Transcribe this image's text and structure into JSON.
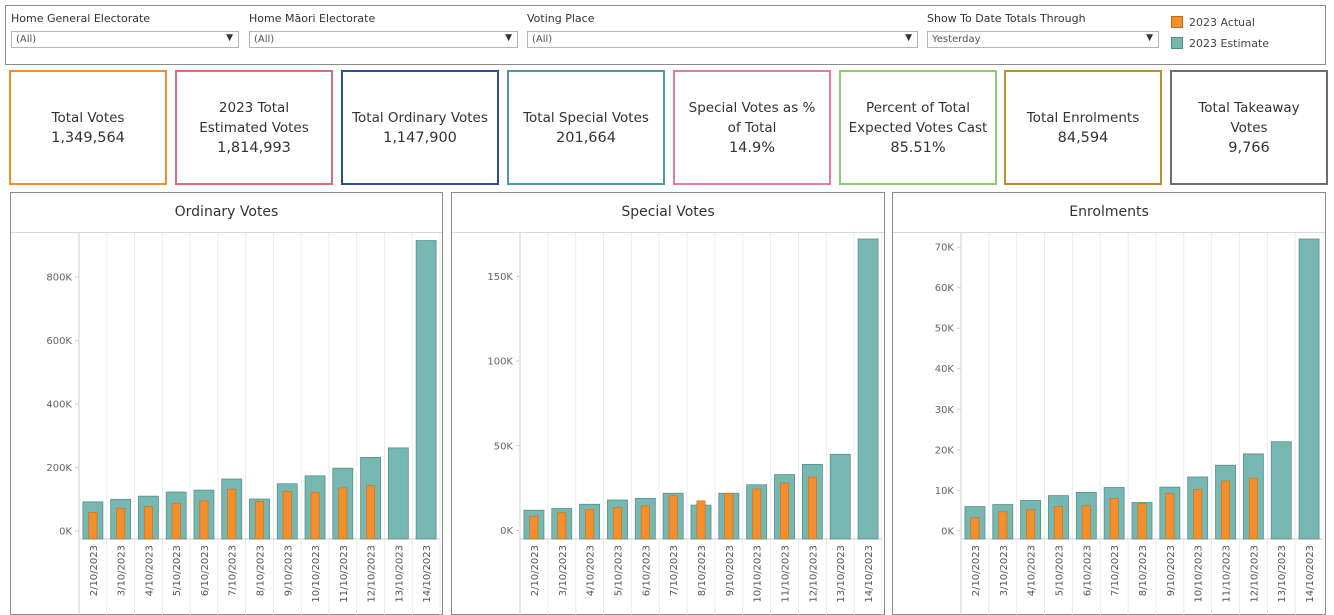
{
  "filters": [
    {
      "label": "Home General Electorate",
      "value": "(All)"
    },
    {
      "label": "Home Māori Electorate",
      "value": "(All)"
    },
    {
      "label": "Voting Place",
      "value": "(All)"
    },
    {
      "label": "Show To Date Totals Through",
      "value": "Yesterday"
    }
  ],
  "legend": {
    "actual": "2023 Actual",
    "estimate": "2023 Estimate"
  },
  "colors": {
    "actual": "#f28e2b",
    "estimate": "#76b7b2"
  },
  "kpis": [
    {
      "title": "Total Votes",
      "value": "1,349,564",
      "color": "#f28e2b"
    },
    {
      "title": "2023 Total Estimated Votes",
      "value": "1,814,993",
      "color": "#e06b7a"
    },
    {
      "title": "Total Ordinary Votes",
      "value": "1,147,900",
      "color": "#2e4ea6"
    },
    {
      "title": "Total Special Votes",
      "value": "201,664",
      "color": "#4e9b98"
    },
    {
      "title": "Special Votes as % of Total",
      "value": "14.9%",
      "color": "#e37aa2"
    },
    {
      "title": "Percent of Total Expected Votes Cast",
      "value": "85.51%",
      "color": "#8ccc6e"
    },
    {
      "title": "Total Enrolments",
      "value": "84,594",
      "color": "#b8912e"
    },
    {
      "title": "Total Takeaway Votes",
      "value": "9,766",
      "color": "#6d6d6d"
    }
  ],
  "chart_data": [
    {
      "type": "bar",
      "title": "Ordinary Votes",
      "categories": [
        "2/10/2023",
        "3/10/2023",
        "4/10/2023",
        "5/10/2023",
        "6/10/2023",
        "7/10/2023",
        "8/10/2023",
        "9/10/2023",
        "10/10/2023",
        "11/10/2023",
        "12/10/2023",
        "13/10/2023",
        "14/10/2023"
      ],
      "series": [
        {
          "name": "2023 Estimate",
          "values": [
            92000,
            100000,
            110000,
            123000,
            129000,
            164000,
            101000,
            149000,
            174000,
            198000,
            232000,
            262000,
            915000
          ]
        },
        {
          "name": "2023 Actual",
          "values": [
            59000,
            72000,
            77000,
            88000,
            95000,
            132000,
            94000,
            125000,
            122000,
            136000,
            143000,
            null,
            null
          ]
        }
      ],
      "ylim": [
        -25000,
        920000
      ],
      "yticks": [
        0,
        200000,
        400000,
        600000,
        800000
      ],
      "ytick_labels": [
        "0K",
        "200K",
        "400K",
        "600K",
        "800K"
      ]
    },
    {
      "type": "bar",
      "title": "Special Votes",
      "categories": [
        "2/10/2023",
        "3/10/2023",
        "4/10/2023",
        "5/10/2023",
        "6/10/2023",
        "7/10/2023",
        "8/10/2023",
        "9/10/2023",
        "10/10/2023",
        "11/10/2023",
        "12/10/2023",
        "13/10/2023",
        "14/10/2023"
      ],
      "series": [
        {
          "name": "2023 Estimate",
          "values": [
            12000,
            13000,
            15500,
            18000,
            19000,
            22000,
            15000,
            22000,
            27000,
            33000,
            39000,
            45000,
            172000
          ]
        },
        {
          "name": "2023 Actual",
          "values": [
            8500,
            10500,
            12500,
            13500,
            14500,
            20500,
            17500,
            22000,
            24500,
            28000,
            31500,
            null,
            null
          ]
        }
      ],
      "ylim": [
        -5000,
        172000
      ],
      "yticks": [
        0,
        50000,
        100000,
        150000
      ],
      "ytick_labels": [
        "0K",
        "50K",
        "100K",
        "150K"
      ]
    },
    {
      "type": "bar",
      "title": "Enrolments",
      "categories": [
        "2/10/2023",
        "3/10/2023",
        "4/10/2023",
        "5/10/2023",
        "6/10/2023",
        "7/10/2023",
        "8/10/2023",
        "9/10/2023",
        "10/10/2023",
        "11/10/2023",
        "12/10/2023",
        "13/10/2023",
        "14/10/2023"
      ],
      "series": [
        {
          "name": "2023 Estimate",
          "values": [
            6000,
            6500,
            7500,
            8700,
            9500,
            10700,
            7000,
            10800,
            13300,
            16200,
            19000,
            22000,
            72000
          ]
        },
        {
          "name": "2023 Actual",
          "values": [
            3200,
            4700,
            5200,
            6000,
            6200,
            8000,
            6800,
            9200,
            10200,
            12300,
            13000,
            null,
            null
          ]
        }
      ],
      "ylim": [
        -2000,
        72000
      ],
      "yticks": [
        0,
        10000,
        20000,
        30000,
        40000,
        50000,
        60000,
        70000
      ],
      "ytick_labels": [
        "0K",
        "10K",
        "20K",
        "30K",
        "40K",
        "50K",
        "60K",
        "70K"
      ]
    }
  ]
}
